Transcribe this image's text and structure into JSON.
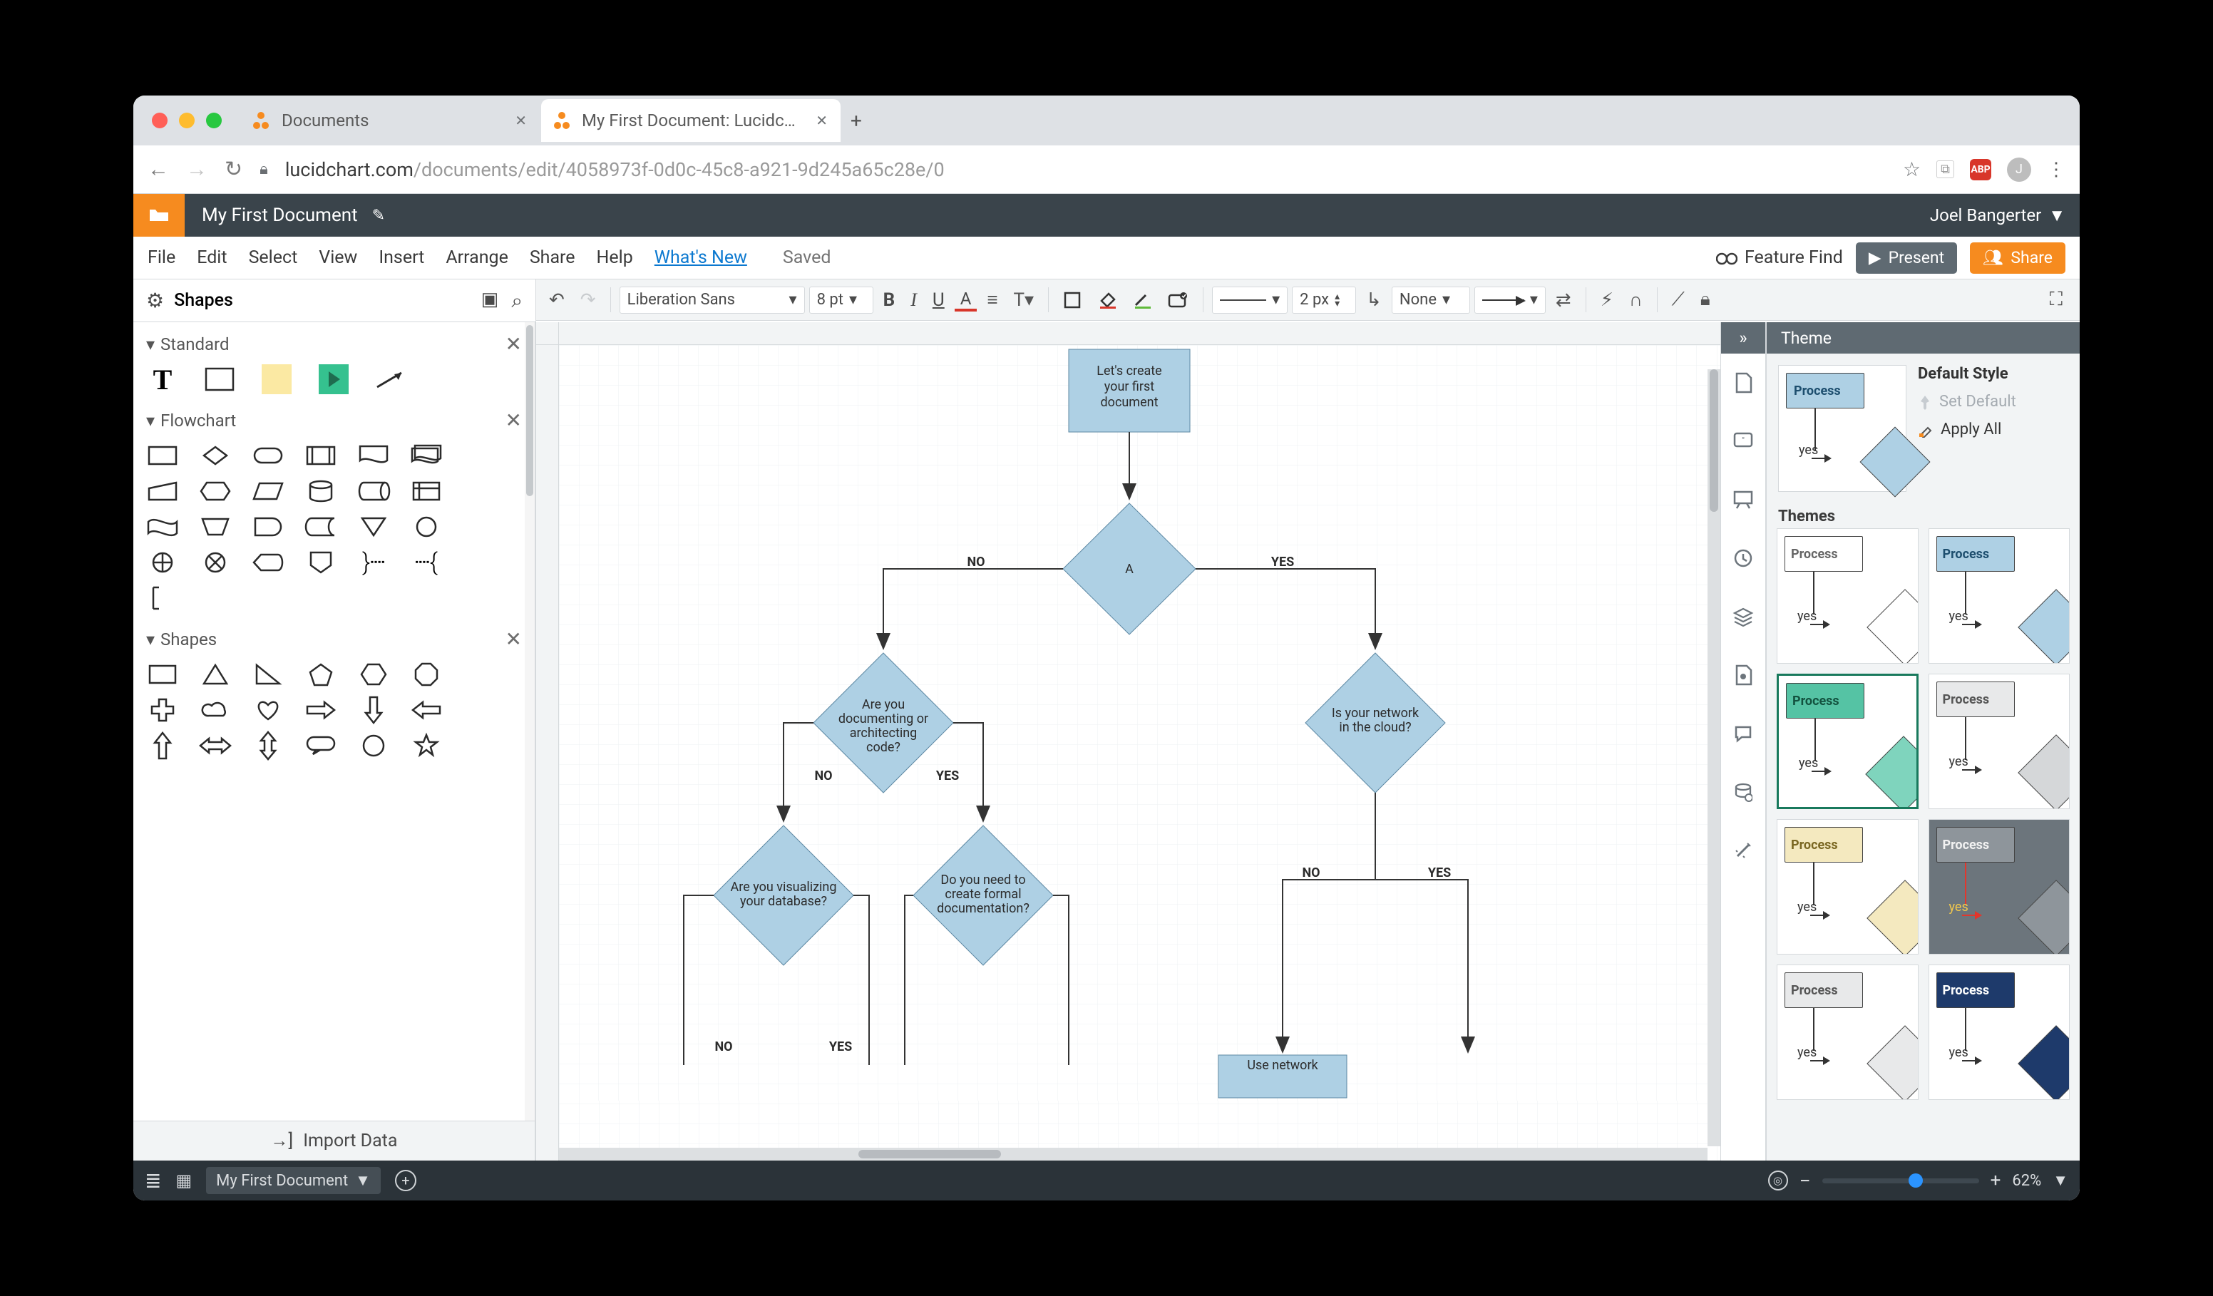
{
  "tabs": [
    {
      "label": "Documents"
    },
    {
      "label": "My First Document: Lucidchart"
    }
  ],
  "url": {
    "domain": "lucidchart.com",
    "path": "/documents/edit/4058973f-0d0c-45c8-a921-9d245a65c28e/0"
  },
  "avatar_letter": "J",
  "ext_badge": "ABP",
  "titlebar": {
    "doc": "My First Document",
    "user": "Joel Bangerter"
  },
  "menubar": {
    "items": [
      "File",
      "Edit",
      "Select",
      "View",
      "Insert",
      "Arrange",
      "Share",
      "Help"
    ],
    "whats_new": "What's New",
    "saved": "Saved",
    "feature_find": "Feature Find",
    "present": "Present",
    "share": "Share"
  },
  "shapes_hdr": "Shapes",
  "toolbar": {
    "font": "Liberation Sans",
    "font_size": "8 pt",
    "stroke": "2 px",
    "border_style": "None"
  },
  "left_sections": [
    "Standard",
    "Flowchart",
    "Shapes"
  ],
  "import_data": "Import Data",
  "canvas": {
    "start": "Let's create your first document",
    "a": "A",
    "no": "NO",
    "yes": "YES",
    "q_code": "Are you documenting or architecting code?",
    "q_cloud": "Is your network in the cloud?",
    "q_db": "Are you visualizing your database?",
    "q_doc": "Do you need to create formal documentation?",
    "net_diag": "Use network"
  },
  "theme": {
    "hdr": "Theme",
    "default_style": "Default Style",
    "set_default": "Set Default",
    "apply_all": "Apply All",
    "themes": "Themes",
    "process": "Process",
    "yes": "yes",
    "cards": [
      {
        "proc_bg": "#ffffff",
        "proc_color": "#666",
        "dec_bg": "#ffffff"
      },
      {
        "proc_bg": "#aed0e4",
        "proc_color": "#1d4e6e",
        "dec_bg": "#aed0e4"
      },
      {
        "proc_bg": "#55c3a4",
        "proc_color": "#13523f",
        "dec_bg": "#7fd4bd",
        "border": "#18795c"
      },
      {
        "proc_bg": "#e8e9ea",
        "proc_color": "#555",
        "dec_bg": "#d5d7d9"
      },
      {
        "proc_bg": "#f4e9bf",
        "proc_color": "#7a6722",
        "dec_bg": "#f4e9bf"
      },
      {
        "proc_bg": "#8e959b",
        "proc_color": "#f2f2f2",
        "dec_bg": "#8e959b",
        "bg": "#6c757c",
        "yes_color": "#f3c94c",
        "arrow": "#e3362c"
      },
      {
        "proc_bg": "#e8e9ea",
        "proc_color": "#555",
        "dec_bg": "#e8e9ea"
      },
      {
        "proc_bg": "#1e3a6b",
        "proc_color": "#fff",
        "dec_bg": "#1e3a6b"
      }
    ]
  },
  "bottombar": {
    "page": "My First Document",
    "zoom": "62%"
  }
}
